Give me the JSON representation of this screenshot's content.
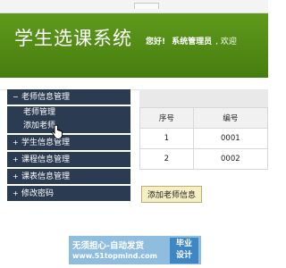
{
  "header": {
    "title": "学生选课系统",
    "greeting": "您好!",
    "user": "系统管理员",
    "welcome": ", 欢迎"
  },
  "sidebar": {
    "sections": [
      {
        "label": "老师信息管理",
        "expanded": true,
        "items": [
          {
            "label": "老师管理"
          },
          {
            "label": "添加老师"
          }
        ]
      },
      {
        "label": "学生信息管理",
        "expanded": false
      },
      {
        "label": "课程信息管理",
        "expanded": false
      },
      {
        "label": "课表信息管理",
        "expanded": false
      },
      {
        "label": "修改密码",
        "expanded": false
      }
    ]
  },
  "table": {
    "headers": [
      "序号",
      "编号"
    ],
    "rows": [
      [
        "1",
        "0001"
      ],
      [
        "2",
        "0002"
      ]
    ]
  },
  "actions": {
    "add_teacher_label": "添加老师信息"
  },
  "watermark": {
    "text": "无须担心-自动发货",
    "url": "www.51topmind.com",
    "badge_line1": "毕业",
    "badge_line2": "设计"
  },
  "colors": {
    "header_green": "#4f8616",
    "menu_navy": "#2a3b52",
    "button_yellow": "#f7efc4"
  }
}
